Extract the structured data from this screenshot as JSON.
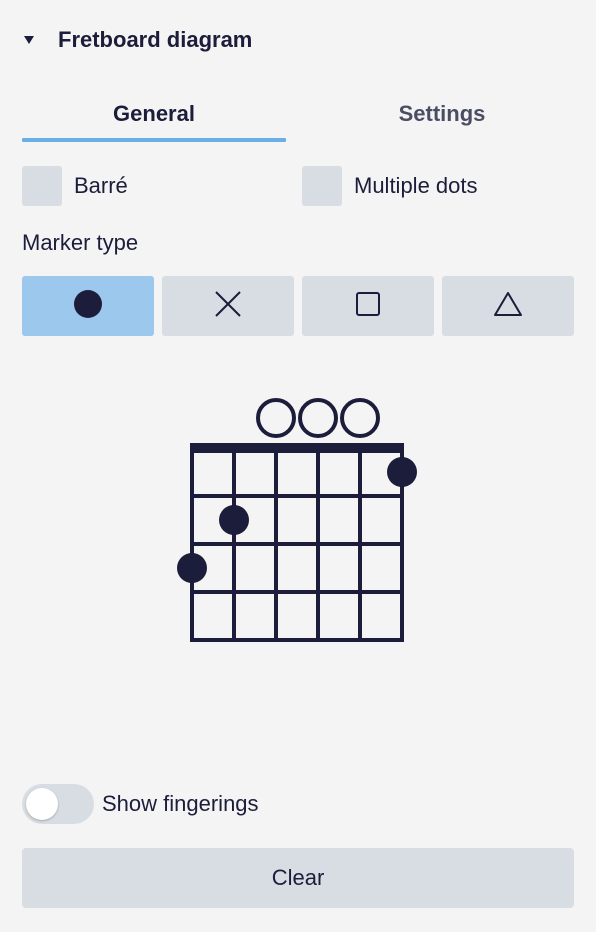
{
  "header": {
    "title": "Fretboard diagram",
    "caret_icon": "triangle-down-icon"
  },
  "tabs": [
    {
      "label": "General",
      "active": true
    },
    {
      "label": "Settings",
      "active": false
    }
  ],
  "options": {
    "barre_label": "Barré",
    "multiple_dots_label": "Multiple dots"
  },
  "marker": {
    "label": "Marker type",
    "types": [
      {
        "icon": "filled-circle-icon",
        "active": true
      },
      {
        "icon": "cross-icon",
        "active": false
      },
      {
        "icon": "square-icon",
        "active": false
      },
      {
        "icon": "triangle-icon",
        "active": false
      }
    ]
  },
  "fretboard": {
    "strings": 6,
    "frets": 4,
    "open_strings": [
      3,
      4,
      5
    ],
    "dots": [
      {
        "string": 1,
        "fret": 3
      },
      {
        "string": 2,
        "fret": 2
      },
      {
        "string": 6,
        "fret": 1
      }
    ]
  },
  "fingerings": {
    "label": "Show fingerings",
    "on": false
  },
  "clear": {
    "label": "Clear"
  },
  "colors": {
    "accent": "#6aaee8",
    "active_button": "#9cc8ee",
    "button": "#d8dde4",
    "ink": "#1b1d3a",
    "background": "#f4f4f4"
  }
}
